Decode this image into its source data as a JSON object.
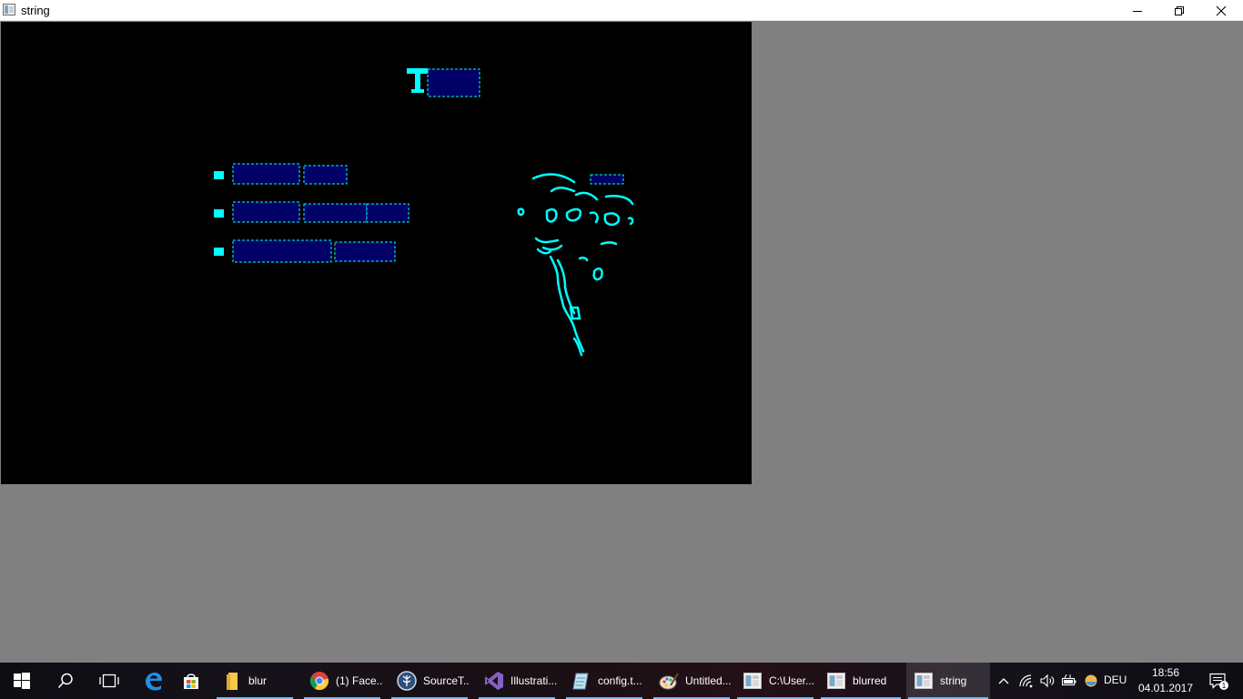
{
  "window": {
    "title": "string",
    "icon": "image-window-icon",
    "controls": [
      "minimize-icon",
      "restore-icon",
      "close-icon"
    ]
  },
  "canvas": {
    "background": "#000000",
    "outline_color": "#00ffff",
    "fill_color": "#000066"
  },
  "taskbar": {
    "apps": [
      {
        "label": "blur",
        "icon": "folder-icon"
      },
      {
        "label": "(1) Face...",
        "icon": "chrome-icon"
      },
      {
        "label": "SourceT...",
        "icon": "sourcetree-icon"
      },
      {
        "label": "Illustrati...",
        "icon": "visual-studio-icon"
      },
      {
        "label": "config.t...",
        "icon": "notepad-icon"
      },
      {
        "label": "Untitled...",
        "icon": "paint-icon"
      },
      {
        "label": "C:\\User...",
        "icon": "image-window-icon"
      },
      {
        "label": "blurred",
        "icon": "image-window-icon"
      },
      {
        "label": "string",
        "icon": "image-window-icon"
      }
    ],
    "language": "DEU",
    "time": "18:56",
    "date": "04.01.2017",
    "notification_count": "1"
  }
}
